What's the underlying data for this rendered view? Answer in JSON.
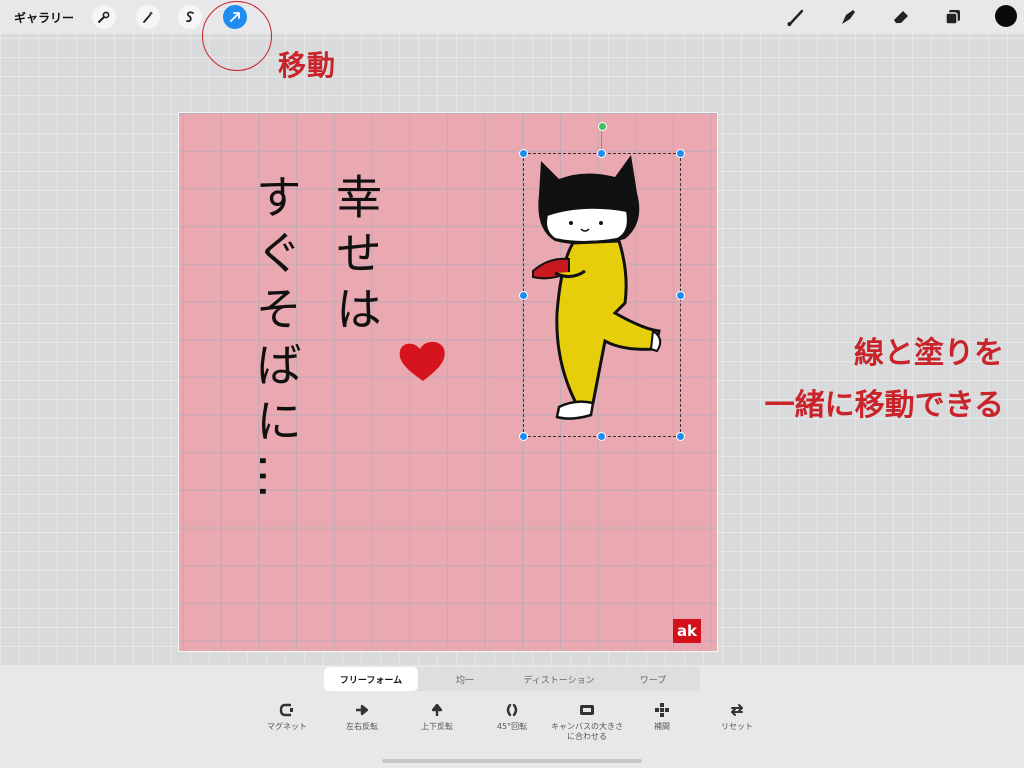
{
  "topbar": {
    "gallery_label": "ギャラリー",
    "tools_left": [
      {
        "name": "actions",
        "icon": "wrench-icon"
      },
      {
        "name": "adjustments",
        "icon": "magic-wand-icon"
      },
      {
        "name": "selection",
        "icon": "selection-s-icon"
      },
      {
        "name": "transform",
        "icon": "arrow-cursor-icon",
        "active": true
      }
    ],
    "tools_right": [
      "brush-icon",
      "smudge-icon",
      "eraser-icon",
      "layers-icon"
    ],
    "current_color": "#0a0a0a",
    "accent": "#1f8cf0"
  },
  "annotations": {
    "move_label": "移動",
    "note_line1": "線と塗りを",
    "note_line2": "一緒に移動できる",
    "color": "#c8242a"
  },
  "canvas": {
    "background": "#eaa8b1",
    "handwriting_col1": "幸せは",
    "handwriting_col2": "すぐそばに…",
    "signature": "ak"
  },
  "transform_bar": {
    "tabs": [
      {
        "label": "フリーフォーム",
        "selected": true
      },
      {
        "label": "均一",
        "selected": false
      },
      {
        "label": "ディストーション",
        "selected": false
      },
      {
        "label": "ワープ",
        "selected": false
      }
    ],
    "actions": [
      {
        "label": "マグネット",
        "icon": "magnet-icon"
      },
      {
        "label": "左右反転",
        "icon": "flip-horizontal-icon"
      },
      {
        "label": "上下反転",
        "icon": "flip-vertical-icon"
      },
      {
        "label": "45°回転",
        "icon": "rotate-45-icon"
      },
      {
        "label": "キャンバスの大きさ",
        "label2": "に合わせる",
        "icon": "fit-to-canvas-icon"
      },
      {
        "label": "補間",
        "icon": "interpolation-icon"
      },
      {
        "label": "リセット",
        "icon": "reset-icon"
      }
    ]
  }
}
